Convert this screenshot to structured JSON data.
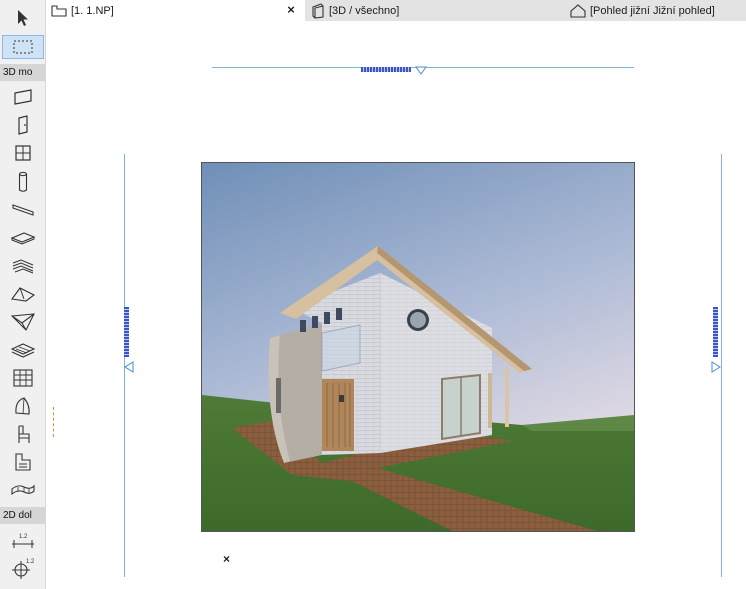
{
  "tabs": [
    {
      "label": "[1. 1.NP]",
      "icon": "floor-plan-icon",
      "active": true
    },
    {
      "label": "[3D / všechno]",
      "icon": "3d-window-icon",
      "active": false
    },
    {
      "label": "[Pohled jižní Jižní pohled]",
      "icon": "elevation-icon",
      "active": false
    }
  ],
  "close_glyph": "×",
  "toolbox": {
    "top_tools": [
      "arrow-select-icon",
      "marquee-icon"
    ],
    "section_3d": "3D mo",
    "tools_3d": [
      "wall-icon",
      "door-icon",
      "window-icon",
      "column-icon",
      "beam-icon",
      "slab-icon",
      "stair-icon",
      "roof-icon",
      "shell-icon",
      "mesh-icon",
      "curtain-wall-icon",
      "morph-icon",
      "object-icon",
      "zone-icon",
      "railing-icon"
    ],
    "section_2d": "2D dol",
    "tools_2d": [
      "dimension-icon",
      "level-dimension-icon"
    ],
    "dimension_superscript": "1.2"
  },
  "canvas": {
    "marker_glyph": "×",
    "render_scene": "3D rendering of a two-storey house with a mono-pitched roof on a grassy lot"
  },
  "colors": {
    "selection_bg": "#cfe3f7",
    "guide_line": "#7fb3d9",
    "handle": "#3a55c8"
  }
}
